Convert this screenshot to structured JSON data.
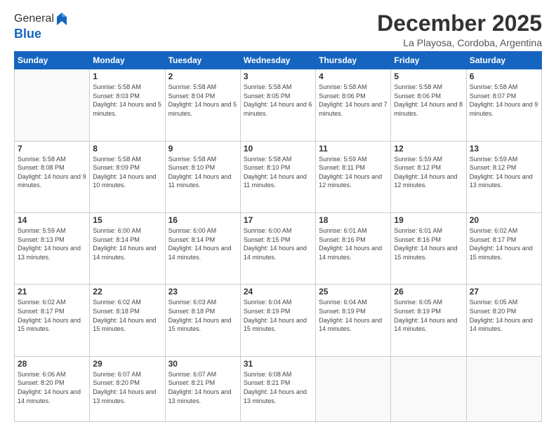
{
  "logo": {
    "general": "General",
    "blue": "Blue"
  },
  "header": {
    "month": "December 2025",
    "location": "La Playosa, Cordoba, Argentina"
  },
  "weekdays": [
    "Sunday",
    "Monday",
    "Tuesday",
    "Wednesday",
    "Thursday",
    "Friday",
    "Saturday"
  ],
  "weeks": [
    [
      {
        "day": "",
        "sunrise": "",
        "sunset": "",
        "daylight": ""
      },
      {
        "day": "1",
        "sunrise": "5:58 AM",
        "sunset": "8:03 PM",
        "daylight": "14 hours and 5 minutes."
      },
      {
        "day": "2",
        "sunrise": "5:58 AM",
        "sunset": "8:04 PM",
        "daylight": "14 hours and 5 minutes."
      },
      {
        "day": "3",
        "sunrise": "5:58 AM",
        "sunset": "8:05 PM",
        "daylight": "14 hours and 6 minutes."
      },
      {
        "day": "4",
        "sunrise": "5:58 AM",
        "sunset": "8:06 PM",
        "daylight": "14 hours and 7 minutes."
      },
      {
        "day": "5",
        "sunrise": "5:58 AM",
        "sunset": "8:06 PM",
        "daylight": "14 hours and 8 minutes."
      },
      {
        "day": "6",
        "sunrise": "5:58 AM",
        "sunset": "8:07 PM",
        "daylight": "14 hours and 9 minutes."
      }
    ],
    [
      {
        "day": "7",
        "sunrise": "5:58 AM",
        "sunset": "8:08 PM",
        "daylight": "14 hours and 9 minutes."
      },
      {
        "day": "8",
        "sunrise": "5:58 AM",
        "sunset": "8:09 PM",
        "daylight": "14 hours and 10 minutes."
      },
      {
        "day": "9",
        "sunrise": "5:58 AM",
        "sunset": "8:10 PM",
        "daylight": "14 hours and 11 minutes."
      },
      {
        "day": "10",
        "sunrise": "5:58 AM",
        "sunset": "8:10 PM",
        "daylight": "14 hours and 11 minutes."
      },
      {
        "day": "11",
        "sunrise": "5:59 AM",
        "sunset": "8:11 PM",
        "daylight": "14 hours and 12 minutes."
      },
      {
        "day": "12",
        "sunrise": "5:59 AM",
        "sunset": "8:12 PM",
        "daylight": "14 hours and 12 minutes."
      },
      {
        "day": "13",
        "sunrise": "5:59 AM",
        "sunset": "8:12 PM",
        "daylight": "14 hours and 13 minutes."
      }
    ],
    [
      {
        "day": "14",
        "sunrise": "5:59 AM",
        "sunset": "8:13 PM",
        "daylight": "14 hours and 13 minutes."
      },
      {
        "day": "15",
        "sunrise": "6:00 AM",
        "sunset": "8:14 PM",
        "daylight": "14 hours and 14 minutes."
      },
      {
        "day": "16",
        "sunrise": "6:00 AM",
        "sunset": "8:14 PM",
        "daylight": "14 hours and 14 minutes."
      },
      {
        "day": "17",
        "sunrise": "6:00 AM",
        "sunset": "8:15 PM",
        "daylight": "14 hours and 14 minutes."
      },
      {
        "day": "18",
        "sunrise": "6:01 AM",
        "sunset": "8:16 PM",
        "daylight": "14 hours and 14 minutes."
      },
      {
        "day": "19",
        "sunrise": "6:01 AM",
        "sunset": "8:16 PM",
        "daylight": "14 hours and 15 minutes."
      },
      {
        "day": "20",
        "sunrise": "6:02 AM",
        "sunset": "8:17 PM",
        "daylight": "14 hours and 15 minutes."
      }
    ],
    [
      {
        "day": "21",
        "sunrise": "6:02 AM",
        "sunset": "8:17 PM",
        "daylight": "14 hours and 15 minutes."
      },
      {
        "day": "22",
        "sunrise": "6:02 AM",
        "sunset": "8:18 PM",
        "daylight": "14 hours and 15 minutes."
      },
      {
        "day": "23",
        "sunrise": "6:03 AM",
        "sunset": "8:18 PM",
        "daylight": "14 hours and 15 minutes."
      },
      {
        "day": "24",
        "sunrise": "6:04 AM",
        "sunset": "8:19 PM",
        "daylight": "14 hours and 15 minutes."
      },
      {
        "day": "25",
        "sunrise": "6:04 AM",
        "sunset": "8:19 PM",
        "daylight": "14 hours and 14 minutes."
      },
      {
        "day": "26",
        "sunrise": "6:05 AM",
        "sunset": "8:19 PM",
        "daylight": "14 hours and 14 minutes."
      },
      {
        "day": "27",
        "sunrise": "6:05 AM",
        "sunset": "8:20 PM",
        "daylight": "14 hours and 14 minutes."
      }
    ],
    [
      {
        "day": "28",
        "sunrise": "6:06 AM",
        "sunset": "8:20 PM",
        "daylight": "14 hours and 14 minutes."
      },
      {
        "day": "29",
        "sunrise": "6:07 AM",
        "sunset": "8:20 PM",
        "daylight": "14 hours and 13 minutes."
      },
      {
        "day": "30",
        "sunrise": "6:07 AM",
        "sunset": "8:21 PM",
        "daylight": "14 hours and 13 minutes."
      },
      {
        "day": "31",
        "sunrise": "6:08 AM",
        "sunset": "8:21 PM",
        "daylight": "14 hours and 13 minutes."
      },
      {
        "day": "",
        "sunrise": "",
        "sunset": "",
        "daylight": ""
      },
      {
        "day": "",
        "sunrise": "",
        "sunset": "",
        "daylight": ""
      },
      {
        "day": "",
        "sunrise": "",
        "sunset": "",
        "daylight": ""
      }
    ]
  ],
  "labels": {
    "sunrise": "Sunrise:",
    "sunset": "Sunset:",
    "daylight": "Daylight:"
  }
}
